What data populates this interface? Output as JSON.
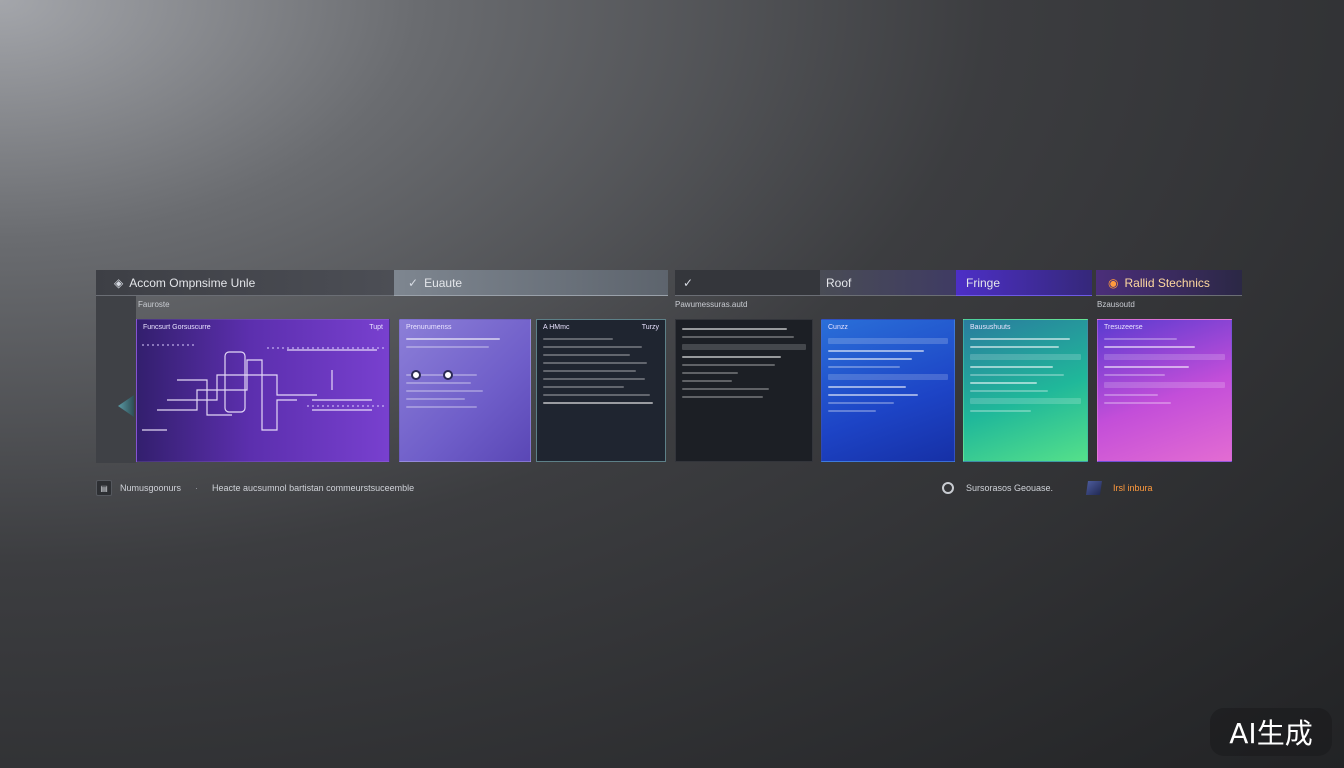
{
  "tabs": [
    {
      "label": "Accom Ompnsime Unle",
      "icon": "layers-icon"
    },
    {
      "label": "Euaute",
      "icon": "checkmark-wave-icon"
    },
    {
      "label": "",
      "icon": "checkmark-wave-icon"
    },
    {
      "label": "Roof",
      "icon": ""
    },
    {
      "label": "Fringe",
      "icon": ""
    },
    {
      "label": "Rallid Stechnics",
      "icon": "circle-icon"
    }
  ],
  "subheaders": {
    "left": "Fauroste",
    "middle": "Pawumessuras.autd",
    "right": "Bzausoutd"
  },
  "cards": [
    {
      "label": "Funcsurt Gorsuscurre",
      "tag": "Tupt"
    },
    {
      "label": "Prenurumenss",
      "tag": ""
    },
    {
      "label": "A HMmc",
      "tag": "Turzy"
    },
    {
      "label": "",
      "tag": ""
    },
    {
      "label": "Cunzz",
      "tag": ""
    },
    {
      "label": "Bausushuuts",
      "tag": ""
    },
    {
      "label": "Tresuzeerse",
      "tag": ""
    }
  ],
  "footer": {
    "left_label": "Numusgoonurs",
    "separator": "·",
    "left_desc": "Heacte aucsumnol bartistan commeurstsuceemble",
    "right_label": "Sursorasos Geouase.",
    "right_link": "Irsl inbura"
  },
  "badge": "AI生成",
  "colors": {
    "accent_purple": "#5c2fae",
    "accent_blue": "#1d44c6",
    "accent_green": "#20b89a",
    "accent_magenta": "#c34ed9",
    "orange": "#ff9a3d"
  }
}
